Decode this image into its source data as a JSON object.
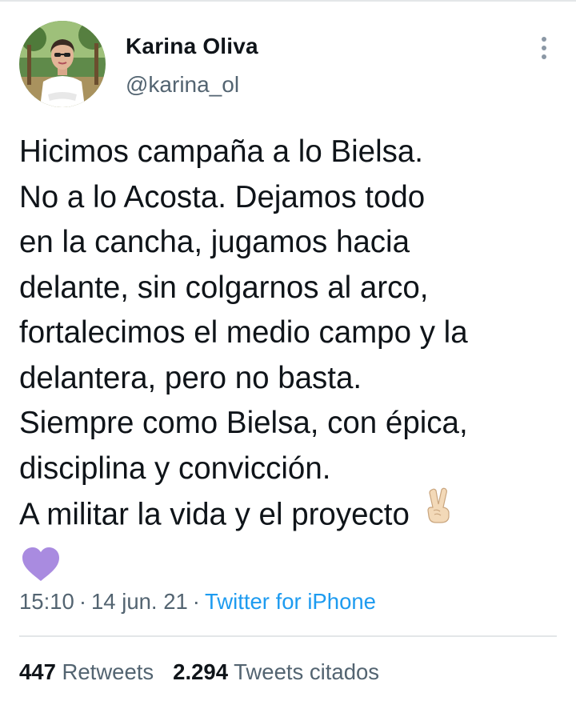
{
  "author": {
    "name": "Karina Oliva",
    "handle": "@karina_ol"
  },
  "tweet": {
    "lines": [
      "Hicimos campaña a lo Bielsa.",
      "No a lo Acosta. Dejamos todo",
      "en la cancha, jugamos hacia",
      "delante, sin colgarnos al arco,",
      "fortalecimos el medio campo y la",
      "delantera, pero no basta.",
      "Siempre como Bielsa, con épica,",
      "disciplina y convicción.",
      "A militar la vida y el proyecto"
    ],
    "emojis": [
      "victory-hand-emoji",
      "purple-heart-emoji"
    ]
  },
  "meta": {
    "time": "15:10",
    "date": "14 jun. 21",
    "separator": "·",
    "source": "Twitter for iPhone"
  },
  "stats": {
    "retweets_count": "447",
    "retweets_label": "Retweets",
    "quotes_count": "2.294",
    "quotes_label": "Tweets citados"
  },
  "colors": {
    "text": "#0f1419",
    "secondary": "#536471",
    "link": "#1d9bf0",
    "divider": "#e3e6e8",
    "heart": "#a98be0"
  }
}
